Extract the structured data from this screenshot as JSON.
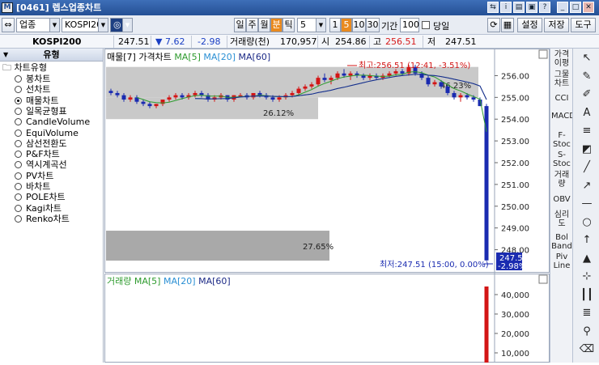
{
  "window": {
    "code": "[0461]",
    "title": "[0461] 렙스업종차트"
  },
  "toolbar": {
    "market": "업종",
    "index": "KOSPI200",
    "period_types": [
      "일",
      "주",
      "월",
      "분",
      "틱"
    ],
    "active_period": "분",
    "interval": "5",
    "quick_intervals": [
      "1",
      "5",
      "10",
      "30"
    ],
    "active_quick": "5",
    "range_label": "기간",
    "range_value": "100",
    "today_label": "당일",
    "buttons": [
      "설정",
      "저장",
      "도구"
    ]
  },
  "info": {
    "name": "KOSPI200",
    "price": "247.51",
    "change": "▼ 7.62",
    "change_rate": "-2.98",
    "volume_label": "거래량(천)",
    "volume": "170,957",
    "open_label": "시",
    "open": "254.86",
    "high_label": "고",
    "high": "256.51",
    "low_label": "저",
    "low": "247.51"
  },
  "sidebar": {
    "header": "유형",
    "root": "차트유형",
    "items": [
      "봉차트",
      "선차트",
      "매물차트",
      "일목균형표",
      "CandleVolume",
      "EquiVolume",
      "삼선전환도",
      "P&F차트",
      "역시계곡선",
      "PV차트",
      "바차트",
      "POLE차트",
      "Kagi차트",
      "Renko차트"
    ],
    "selected": "매물차트"
  },
  "price_panel": {
    "title": "매물[7] 가격차트",
    "ma": [
      "MA[5]",
      "MA[20]",
      "MA[60]"
    ],
    "high_annotation": "최고:256.51 (12:41, -3.51%)",
    "low_annotation": "최저:247.51 (15:00, 0.00%)",
    "last_price": "247.51",
    "last_change": "-2.98%",
    "y_ticks": [
      "256.00",
      "255.00",
      "254.00",
      "253.00",
      "252.00",
      "251.00",
      "250.00",
      "249.00",
      "248.00"
    ]
  },
  "volume_panel": {
    "title": "거래량",
    "ma": [
      "MA[5]",
      "MA[20]",
      "MA[60]"
    ],
    "y_ticks": [
      "40,000",
      "30,000",
      "20,000",
      "10,000"
    ]
  },
  "right_indicators": [
    "가격이평",
    "그물차트",
    "CCI",
    "MACD",
    "F-Stoc",
    "S-Stoc",
    "거래량",
    "OBV",
    "심리도",
    "Bol Band",
    "Piv Line"
  ],
  "chart_data": {
    "type": "candlestick",
    "unit_minutes": 5,
    "ohlc": [
      [
        255.3,
        255.4,
        255.1,
        255.2
      ],
      [
        255.2,
        255.3,
        255.0,
        255.1
      ],
      [
        255.1,
        255.2,
        254.8,
        254.9
      ],
      [
        254.9,
        255.1,
        254.8,
        255.0
      ],
      [
        255.0,
        255.1,
        254.7,
        254.8
      ],
      [
        254.8,
        254.9,
        254.6,
        254.7
      ],
      [
        254.7,
        254.8,
        254.5,
        254.6
      ],
      [
        254.6,
        254.7,
        254.5,
        254.7
      ],
      [
        254.7,
        254.9,
        254.6,
        254.9
      ],
      [
        254.9,
        255.1,
        254.8,
        255.0
      ],
      [
        255.0,
        255.2,
        254.9,
        255.1
      ],
      [
        255.1,
        255.2,
        254.9,
        255.0
      ],
      [
        255.0,
        255.2,
        254.9,
        255.1
      ],
      [
        255.1,
        255.3,
        255.0,
        255.2
      ],
      [
        255.2,
        255.3,
        255.0,
        255.1
      ],
      [
        255.1,
        255.2,
        254.8,
        254.9
      ],
      [
        254.9,
        255.1,
        254.8,
        255.0
      ],
      [
        255.0,
        255.2,
        254.9,
        255.1
      ],
      [
        255.1,
        255.1,
        254.8,
        254.9
      ],
      [
        254.9,
        255.1,
        254.8,
        255.1
      ],
      [
        255.1,
        255.2,
        255.0,
        255.1
      ],
      [
        255.1,
        255.2,
        254.9,
        255.0
      ],
      [
        255.0,
        255.2,
        254.9,
        255.2
      ],
      [
        255.2,
        255.3,
        255.0,
        255.1
      ],
      [
        255.1,
        255.2,
        254.9,
        255.0
      ],
      [
        255.0,
        255.1,
        254.8,
        254.9
      ],
      [
        254.9,
        255.1,
        254.8,
        255.0
      ],
      [
        255.0,
        255.2,
        254.9,
        255.1
      ],
      [
        255.1,
        255.3,
        255.0,
        255.2
      ],
      [
        255.2,
        255.5,
        255.1,
        255.4
      ],
      [
        255.4,
        255.6,
        255.3,
        255.5
      ],
      [
        255.5,
        255.7,
        255.4,
        255.6
      ],
      [
        255.6,
        256.0,
        255.5,
        255.9
      ],
      [
        255.9,
        256.1,
        255.7,
        255.8
      ],
      [
        255.8,
        256.0,
        255.6,
        255.9
      ],
      [
        255.9,
        256.2,
        255.8,
        256.1
      ],
      [
        256.1,
        256.3,
        255.9,
        256.0
      ],
      [
        256.0,
        256.2,
        255.8,
        256.1
      ],
      [
        256.1,
        256.2,
        255.9,
        256.0
      ],
      [
        256.0,
        256.1,
        255.8,
        255.9
      ],
      [
        255.9,
        256.1,
        255.8,
        256.0
      ],
      [
        256.0,
        256.1,
        255.8,
        255.9
      ],
      [
        255.9,
        256.1,
        255.8,
        256.0
      ],
      [
        256.0,
        256.2,
        255.9,
        256.1
      ],
      [
        256.1,
        256.3,
        256.0,
        256.2
      ],
      [
        256.2,
        256.3,
        256.0,
        256.1
      ],
      [
        256.1,
        256.5,
        256.0,
        256.4
      ],
      [
        256.4,
        256.5,
        256.0,
        256.1
      ],
      [
        256.1,
        256.2,
        255.8,
        255.9
      ],
      [
        255.9,
        256.0,
        255.5,
        255.6
      ],
      [
        255.6,
        255.8,
        255.5,
        255.7
      ],
      [
        255.7,
        255.8,
        255.4,
        255.5
      ],
      [
        255.5,
        255.6,
        255.1,
        255.2
      ],
      [
        255.2,
        255.3,
        254.9,
        255.0
      ],
      [
        255.0,
        255.2,
        254.8,
        255.1
      ],
      [
        255.1,
        255.2,
        254.9,
        255.0
      ],
      [
        255.0,
        255.1,
        254.8,
        254.9
      ],
      [
        254.9,
        255.0,
        254.6,
        254.6
      ],
      [
        254.6,
        254.7,
        247.5,
        247.51
      ]
    ],
    "volume_profile": [
      {
        "price_from": 255.0,
        "price_to": 256.4,
        "percent": 0
      },
      {
        "price_from": 254.0,
        "price_to": 255.0,
        "percent": 26.12
      },
      {
        "price_from": 247.5,
        "price_to": 248.8,
        "percent": 27.65
      }
    ],
    "profile_labels": [
      "46.23%",
      "26.12%",
      "27.65%"
    ],
    "ylim": [
      247.5,
      256.5
    ]
  }
}
